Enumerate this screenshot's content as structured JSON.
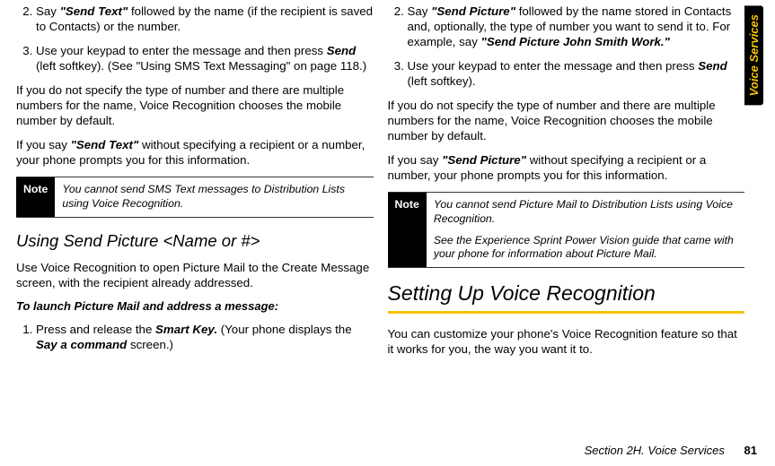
{
  "left": {
    "step2_pre": "Say ",
    "step2_bold": "\"Send Text\"",
    "step2_post": " followed by the name (if the recipient is saved to Contacts) or the number.",
    "step3_pre": "Use your keypad to enter the message and then press ",
    "step3_bold": "Send",
    "step3_post": " (left softkey). (See \"Using SMS Text Messaging\" on page 118.)",
    "para1": "If you do not specify the type of number and there are multiple numbers for the name, Voice Recognition chooses the mobile number by default.",
    "para2_pre": "If you say ",
    "para2_bold": "\"Send Text\"",
    "para2_post": " without specifying a recipient or a number, your phone prompts you for this information.",
    "note_label": "Note",
    "note_body": "You cannot send SMS Text messages to Distribution Lists using Voice Recognition.",
    "h2": "Using Send Picture <Name or #>",
    "desc": "Use Voice Recognition to open Picture Mail to the Create Message screen, with the recipient already addressed.",
    "procedure": "To launch Picture Mail and address a message:",
    "pm_step1_pre": "Press and release the ",
    "pm_step1_bold": "Smart Key.",
    "pm_step1_mid": " (Your phone displays the ",
    "pm_step1_bold2": "Say a command",
    "pm_step1_post": " screen.)"
  },
  "right": {
    "step2_pre": "Say ",
    "step2_bold": "\"Send Picture\"",
    "step2_mid": " followed by the name stored in Contacts and, optionally, the type of number you want to send it to. For example, say ",
    "step2_bold2": "\"Send Picture John Smith Work.\"",
    "step3_pre": "Use your keypad to enter the message and then press ",
    "step3_bold": "Send",
    "step3_post": " (left softkey).",
    "para1": "If you do not specify the type of number and there are multiple numbers for the name, Voice Recognition chooses the mobile number by default.",
    "para2_pre": "If you say ",
    "para2_bold": "\"Send Picture\"",
    "para2_post": " without specifying a recipient or a number, your phone prompts you for this information.",
    "note_label": "Note",
    "note_body1": "You cannot send Picture Mail to Distribution Lists using Voice Recognition.",
    "note_body2": "See the Experience Sprint Power Vision guide that came with your phone for information about Picture Mail.",
    "h1": "Setting Up Voice Recognition",
    "desc": "You can customize your phone's Voice Recognition feature so that it works for you, the way you want it to."
  },
  "sidebar": "Voice Services",
  "footer_section": "Section 2H. Voice Services",
  "footer_page": "81"
}
